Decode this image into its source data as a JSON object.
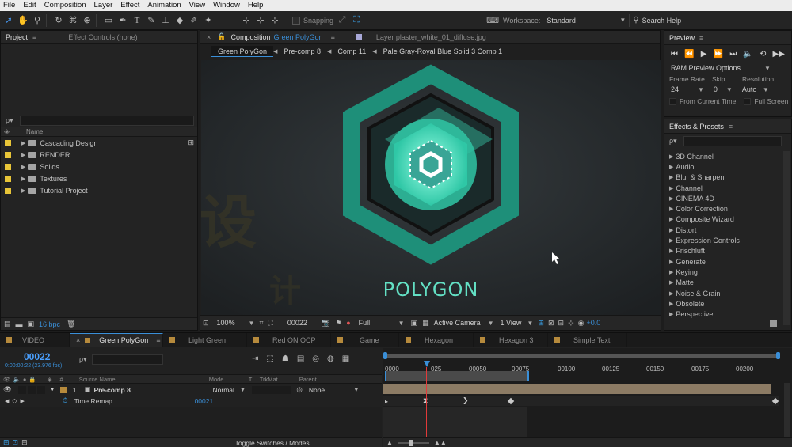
{
  "menu": [
    "File",
    "Edit",
    "Composition",
    "Layer",
    "Effect",
    "Animation",
    "View",
    "Window",
    "Help"
  ],
  "toolbar": {
    "snapping_label": "Snapping",
    "workspace_label": "Workspace:",
    "workspace_value": "Standard",
    "search_help_placeholder": "Search Help"
  },
  "project_panel": {
    "tab_project": "Project",
    "tab_effect_controls": "Effect Controls (none)",
    "column_name": "Name",
    "search_glyph": "ρ▾",
    "items": [
      {
        "label": "Cascading Design"
      },
      {
        "label": "RENDER"
      },
      {
        "label": "Solids"
      },
      {
        "label": "Textures"
      },
      {
        "label": "Tutorial Project"
      }
    ],
    "bpc_label": "16 bpc"
  },
  "composition_panel": {
    "tab_composition_prefix": "Composition",
    "tab_composition_name": "Green PolyGon",
    "tab_layer": "Layer  plaster_white_01_diffuse.jpg",
    "breadcrumbs": [
      "Green PolyGon",
      "Pre-comp 8",
      "Comp 11",
      "Pale Gray-Royal Blue Solid 3 Comp 1"
    ],
    "artwork_title": "POLYGON",
    "zoom": "100%",
    "timecode": "00022",
    "resolution": "Full",
    "camera": "Active Camera",
    "views": "1 View",
    "exposure": "+0.0"
  },
  "preview_panel": {
    "title": "Preview",
    "ram_preview_options": "RAM Preview Options",
    "frame_rate_label": "Frame Rate",
    "skip_label": "Skip",
    "resolution_label": "Resolution",
    "frame_rate_value": "24",
    "skip_value": "0",
    "resolution_value": "Auto",
    "from_current_time": "From Current Time",
    "full_screen": "Full Screen"
  },
  "effects_panel": {
    "title": "Effects & Presets",
    "items": [
      "3D Channel",
      "Audio",
      "Blur & Sharpen",
      "Channel",
      "CINEMA 4D",
      "Color Correction",
      "Composite Wizard",
      "Distort",
      "Expression Controls",
      "Frischluft",
      "Generate",
      "Keying",
      "Matte",
      "Noise & Grain",
      "Obsolete",
      "Perspective"
    ]
  },
  "timeline": {
    "tabs": [
      {
        "label": "VIDEO",
        "active": false
      },
      {
        "label": "Green PolyGon",
        "active": true
      },
      {
        "label": "Light Green",
        "active": false
      },
      {
        "label": "Red ON OCP",
        "active": false
      },
      {
        "label": "Game",
        "active": false
      },
      {
        "label": "Hexagon",
        "active": false
      },
      {
        "label": "Hexagon 3",
        "active": false
      },
      {
        "label": "Simple Text",
        "active": false
      }
    ],
    "current_time": "00022",
    "timecode_sub": "0:00:00:22 (23.976 fps)",
    "columns": {
      "hash": "#",
      "source_name": "Source Name",
      "mode": "Mode",
      "t": "T",
      "trkmat": "TrkMat",
      "parent": "Parent"
    },
    "layer": {
      "index": "1",
      "name": "Pre-comp 8",
      "mode": "Normal",
      "parent": "None"
    },
    "property": {
      "name": "Time Remap",
      "value": "00021"
    },
    "ruler": [
      "0000",
      "025",
      "00050",
      "00075",
      "00100",
      "00125",
      "00150",
      "00175",
      "00200"
    ],
    "toggle_label": "Toggle Switches / Modes"
  },
  "colors": {
    "accent_blue": "#2d8ceb",
    "timecode_blue": "#4aa0ff",
    "artwork_teal": "#2fc7a6",
    "playhead_red": "#e23a3a"
  }
}
